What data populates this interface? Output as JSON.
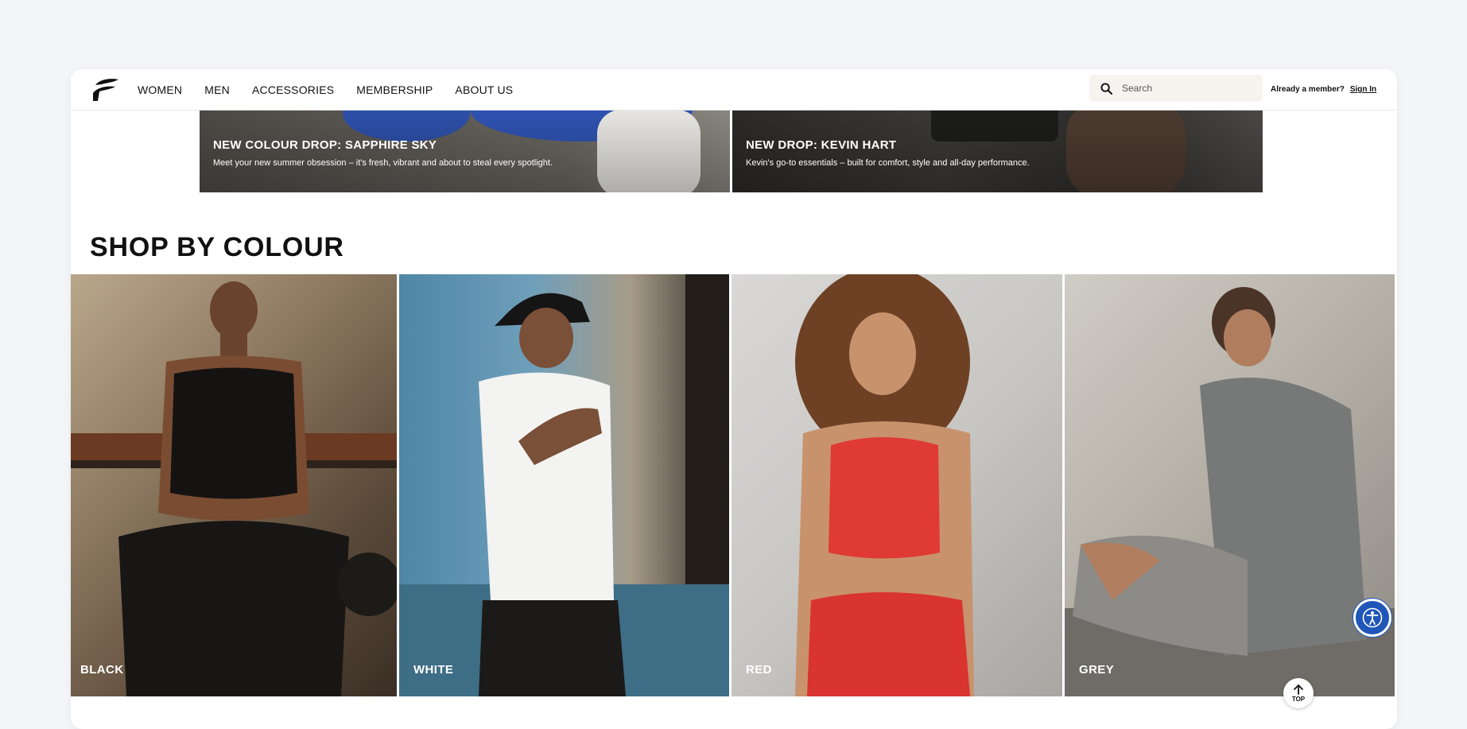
{
  "brand": {
    "logo_icon": "fabletics-logo-icon"
  },
  "nav": {
    "items": [
      "WOMEN",
      "MEN",
      "ACCESSORIES",
      "MEMBERSHIP",
      "ABOUT US"
    ]
  },
  "search": {
    "placeholder": "Search",
    "icon": "search-icon"
  },
  "account": {
    "prompt": "Already a member?",
    "signin": "Sign In"
  },
  "promos": [
    {
      "title": "NEW COLOUR DROP: SAPPHIRE SKY",
      "text": "Meet your new summer obsession – it's fresh, vibrant and about to steal every spotlight."
    },
    {
      "title": "NEW DROP: KEVIN HART",
      "text": "Kevin's go-to essentials – built for comfort, style and all-day performance."
    }
  ],
  "section": {
    "title": "SHOP BY COLOUR"
  },
  "colours": [
    {
      "label": "BLACK"
    },
    {
      "label": "WHITE"
    },
    {
      "label": "RED"
    },
    {
      "label": "GREY"
    }
  ],
  "widgets": {
    "top_label": "TOP",
    "accessibility_icon": "accessibility-icon"
  },
  "colors": {
    "page_bg": "#f3f5f9",
    "accessibility": "#1f56b8",
    "red_top": "#e03a34"
  }
}
